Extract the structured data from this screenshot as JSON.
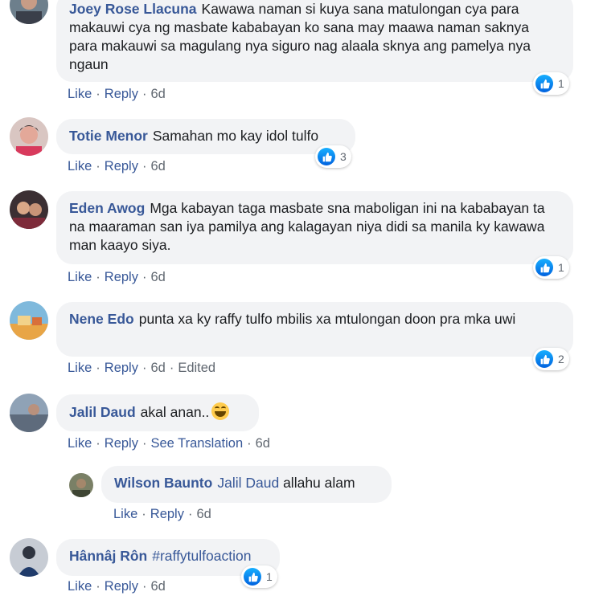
{
  "colors": {
    "link": "#385898",
    "bubble": "#f2f3f5",
    "like": "#1877f2"
  },
  "comments": [
    {
      "author": "Joey Rose Llacuna",
      "text": "Kawawa naman si kuya sana matulongan cya para makauwi cya ng masbate kababayan ko sana may maawa naman saknya para makauwi sa magulang nya siguro nag alaala sknya ang pamelya nya ngaun",
      "like": "Like",
      "reply": "Reply",
      "time": "6d",
      "reactions": "1"
    },
    {
      "author": "Totie Menor",
      "text": "Samahan mo kay idol tulfo",
      "like": "Like",
      "reply": "Reply",
      "time": "6d",
      "reactions": "3"
    },
    {
      "author": "Eden Awog",
      "text": "Mga kabayan taga masbate sna maboligan ini na kababayan ta na maaraman san iya pamilya ang kalagayan niya didi sa manila ky kawawa man kaayo siya.",
      "like": "Like",
      "reply": "Reply",
      "time": "6d",
      "reactions": "1"
    },
    {
      "author": "Nene Edo",
      "text": "punta xa ky raffy tulfo mbilis xa mtulongan doon pra mka uwi",
      "like": "Like",
      "reply": "Reply",
      "time": "6d",
      "edited": "Edited",
      "reactions": "2"
    },
    {
      "author": "Jalil Daud",
      "text": "akal anan..",
      "emoji": "laughing-emoji",
      "like": "Like",
      "reply": "Reply",
      "translate": "See Translation",
      "time": "6d"
    },
    {
      "author": "Wilson Baunto",
      "mention": "Jalil Daud",
      "text": "allahu alam",
      "like": "Like",
      "reply": "Reply",
      "time": "6d"
    },
    {
      "author": "Hânnâj Rôn",
      "text": "#raffytulfoaction",
      "like": "Like",
      "reply": "Reply",
      "time": "6d",
      "reactions": "1"
    }
  ],
  "icons": {
    "like_reaction": "thumbs-up-icon"
  }
}
